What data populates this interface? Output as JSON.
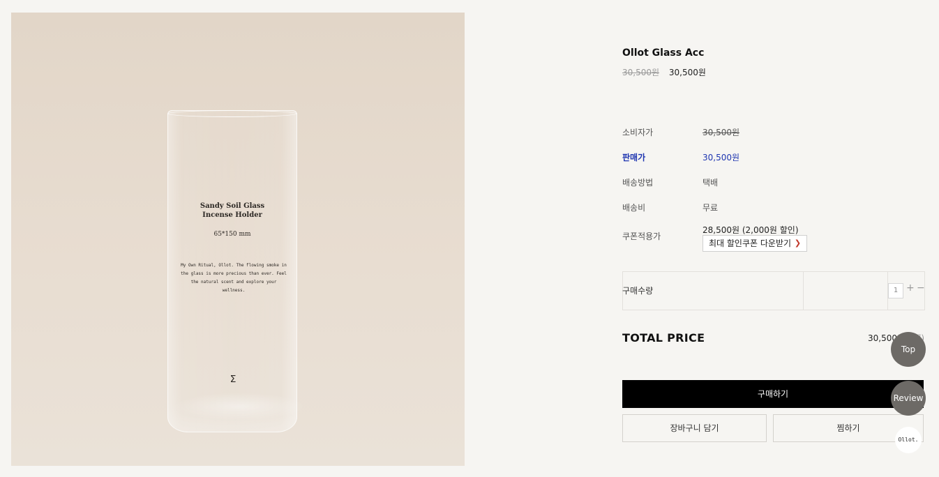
{
  "product": {
    "image_caption_line1": "Sandy Soil Glass",
    "image_caption_line2": "Incense Holder",
    "image_size": "65*150 mm",
    "image_paragraph": "My Own Ritual, Ollot. The flowing smoke in the glass is more precious than ever. Feel the natural scent and explore your wellness.",
    "image_logo": "ⵉ",
    "name": "Ollot Glass Acc",
    "price_original": "30,500원",
    "price_sale": "30,500원"
  },
  "info": {
    "retail_label": "소비자가",
    "retail_value": "30,500원",
    "sale_label": "판매가",
    "sale_value": "30,500원",
    "shipping_method_label": "배송방법",
    "shipping_method_value": "택배",
    "shipping_fee_label": "배송비",
    "shipping_fee_value": "무료",
    "coupon_label": "쿠폰적용가",
    "coupon_value": "28,500원 (2,000원 할인)",
    "coupon_button": "최대 할인쿠폰 다운받기"
  },
  "quantity": {
    "label": "구매수량",
    "value": "1",
    "plus": "+",
    "minus": "−"
  },
  "total": {
    "label": "TOTAL PRICE",
    "value": "30,500원",
    "unit": "(1개)"
  },
  "actions": {
    "buy": "구매하기",
    "cart": "장바구니 담기",
    "wishlist": "찜하기"
  },
  "floating": {
    "top": "Top",
    "review": "Review",
    "brand": "Ollot."
  },
  "colors": {
    "background": "#f6f5f2",
    "sale_accent": "#1e35b0",
    "buy_button": "#000000",
    "fab": "#6d6a66"
  }
}
